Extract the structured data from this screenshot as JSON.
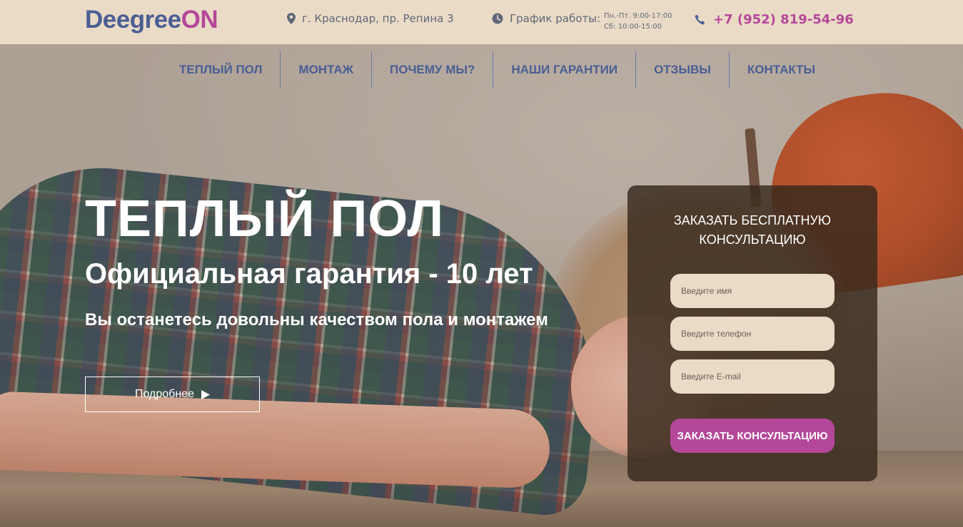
{
  "logo": {
    "part1": "Deegree",
    "part2": "ON"
  },
  "header": {
    "address": "г. Краснодар, пр. Репина 3",
    "schedule_label": "График работы:",
    "schedule_weekdays": "Пн.-Пт. 9:00-17:00",
    "schedule_saturday": "Сб: 10:00-15:00",
    "phone": "+7 (952) 819-54-96"
  },
  "nav": {
    "items": [
      {
        "label": "ТЕПЛЫЙ ПОЛ"
      },
      {
        "label": "МОНТАЖ"
      },
      {
        "label": "ПОЧЕМУ МЫ?"
      },
      {
        "label": "НАШИ ГАРАНТИИ"
      },
      {
        "label": "ОТЗЫВЫ"
      },
      {
        "label": "КОНТАКТЫ"
      }
    ]
  },
  "hero": {
    "title": "ТЕПЛЫЙ ПОЛ",
    "subtitle": "Официальная гарантия - 10 лет",
    "tagline": "Вы останетесь довольны качеством пола и монтажем",
    "more_label": "Подробнее"
  },
  "form": {
    "title_line1": "ЗАКАЗАТЬ БЕСПЛАТНУЮ",
    "title_line2": "КОНСУЛЬТАЦИЮ",
    "name_placeholder": "Введите имя",
    "phone_placeholder": "Введите телефон",
    "email_placeholder": "Введите E-mail",
    "submit_label": "ЗАКАЗАТЬ КОНСУЛЬТАЦИЮ"
  },
  "colors": {
    "brand_blue": "#4a5e94",
    "brand_pink": "#b5479a",
    "header_bg": "#eadbc6",
    "form_bg": "#372819"
  },
  "icons": {
    "address": "map-marker-icon",
    "schedule": "clock-icon",
    "phone": "phone-icon",
    "more": "play-arrow-icon"
  }
}
